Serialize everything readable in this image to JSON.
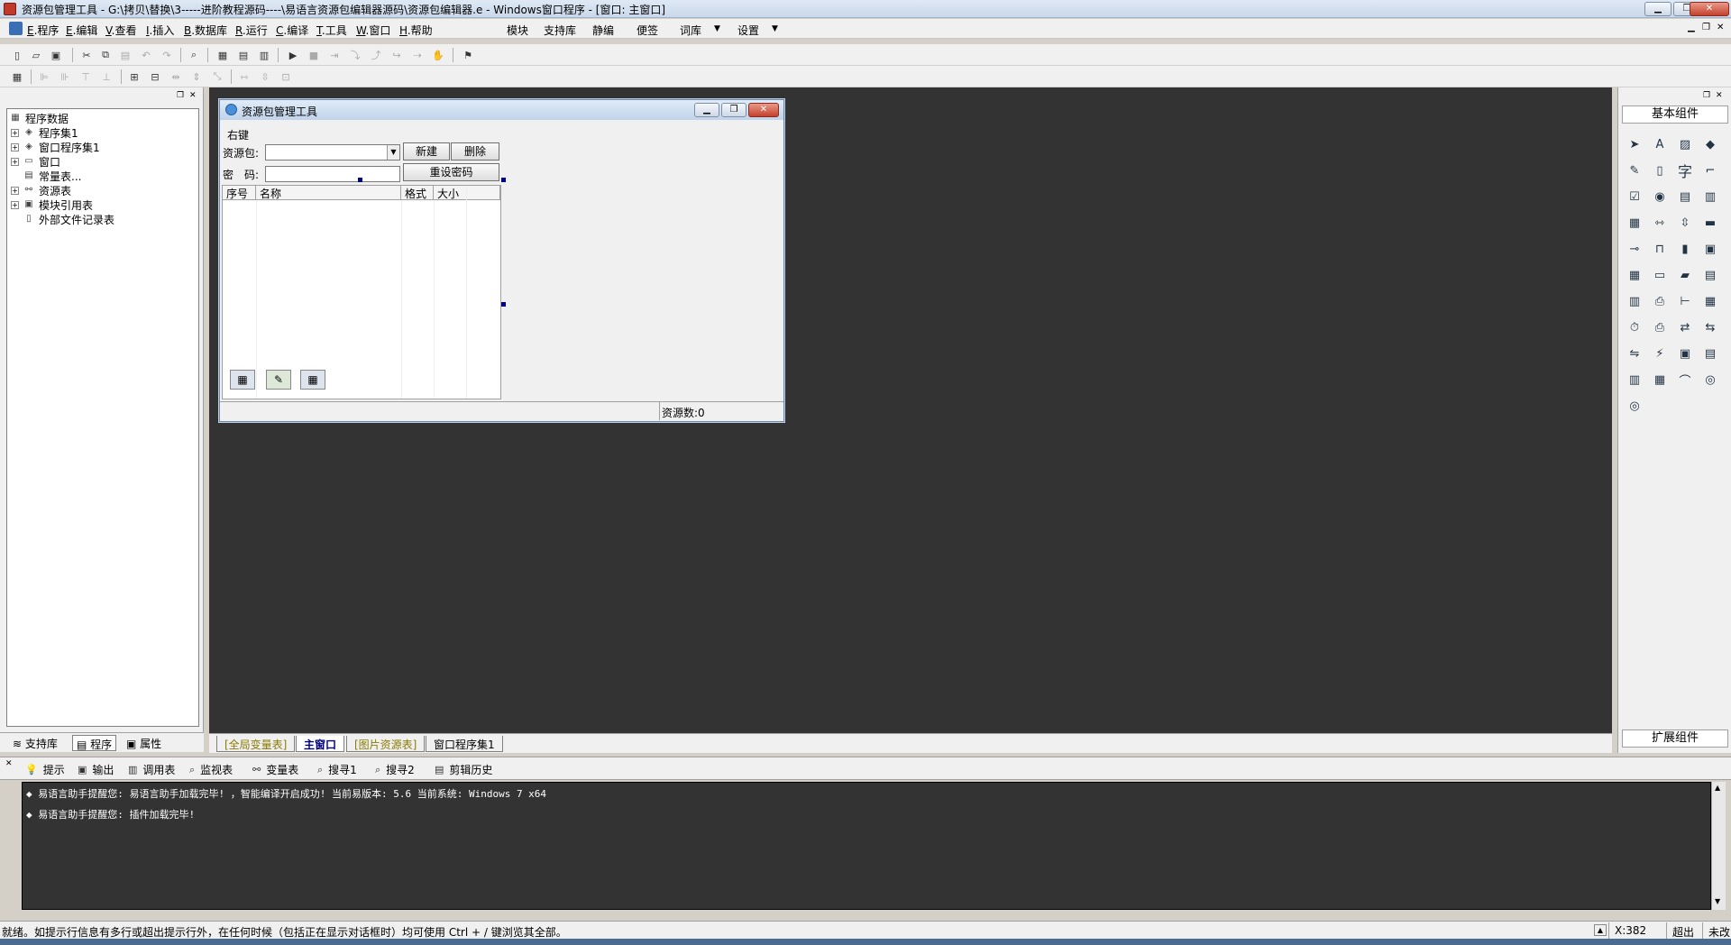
{
  "window": {
    "title": "资源包管理工具 - G:\\拷贝\\替换\\3-----进阶教程源码----\\易语言资源包编辑器源码\\资源包编辑器.e - Windows窗口程序 - [窗口: 主窗口]"
  },
  "menubar": {
    "items": [
      {
        "key": "E",
        "label": ".程序"
      },
      {
        "key": "E",
        "label": ".编辑"
      },
      {
        "key": "V",
        "label": ".查看"
      },
      {
        "key": "I",
        "label": ".插入"
      },
      {
        "key": "B",
        "label": ".数据库"
      },
      {
        "key": "R",
        "label": ".运行"
      },
      {
        "key": "C",
        "label": ".编译"
      },
      {
        "key": "T",
        "label": ".工具"
      },
      {
        "key": "W",
        "label": ".窗口"
      },
      {
        "key": "H",
        "label": ".帮助"
      }
    ],
    "extra": [
      "模块",
      "支持库",
      "静编",
      "便签",
      "词库",
      "设置"
    ]
  },
  "tree": {
    "items": [
      "程序数据",
      "程序集1",
      "窗口程序集1",
      "窗口",
      "常量表...",
      "资源表",
      "模块引用表",
      "外部文件记录表"
    ]
  },
  "lefttabs": [
    "支持库",
    "程序",
    "属性"
  ],
  "form": {
    "title": "资源包管理工具",
    "menu_label": "右键",
    "pack_label": "资源包:",
    "new_button": "新建",
    "delete_button": "删除",
    "password_label": "密　码:",
    "reset_button": "重设密码",
    "columns": [
      "序号",
      "名称",
      "格式",
      "大小"
    ],
    "status": "资源数:0"
  },
  "designtabs": [
    "[全局变量表]",
    "主窗口",
    "[图片资源表]",
    "窗口程序集1"
  ],
  "rightpanel": {
    "title": "基本组件",
    "footer": "扩展组件",
    "text_glyph": "字"
  },
  "outtabs": [
    "提示",
    "输出",
    "调用表",
    "监视表",
    "变量表",
    "搜寻1",
    "搜寻2",
    "剪辑历史"
  ],
  "output": {
    "lines": [
      "◆ 易语言助手提醒您: 易语言助手加载完毕!  ，智能编译开启成功!  当前易版本: 5.6  当前系统: Windows 7 x64",
      "◆ 易语言助手提醒您: 插件加载完毕!"
    ]
  },
  "statusbar": {
    "text": "就绪。如提示行信息有多行或超出提示行外，在任何时候（包括正在显示对话框时）均可使用 Ctrl + / 键浏览其全部。",
    "coord": "X:382",
    "overwrite": "超出",
    "modified": "未改"
  }
}
